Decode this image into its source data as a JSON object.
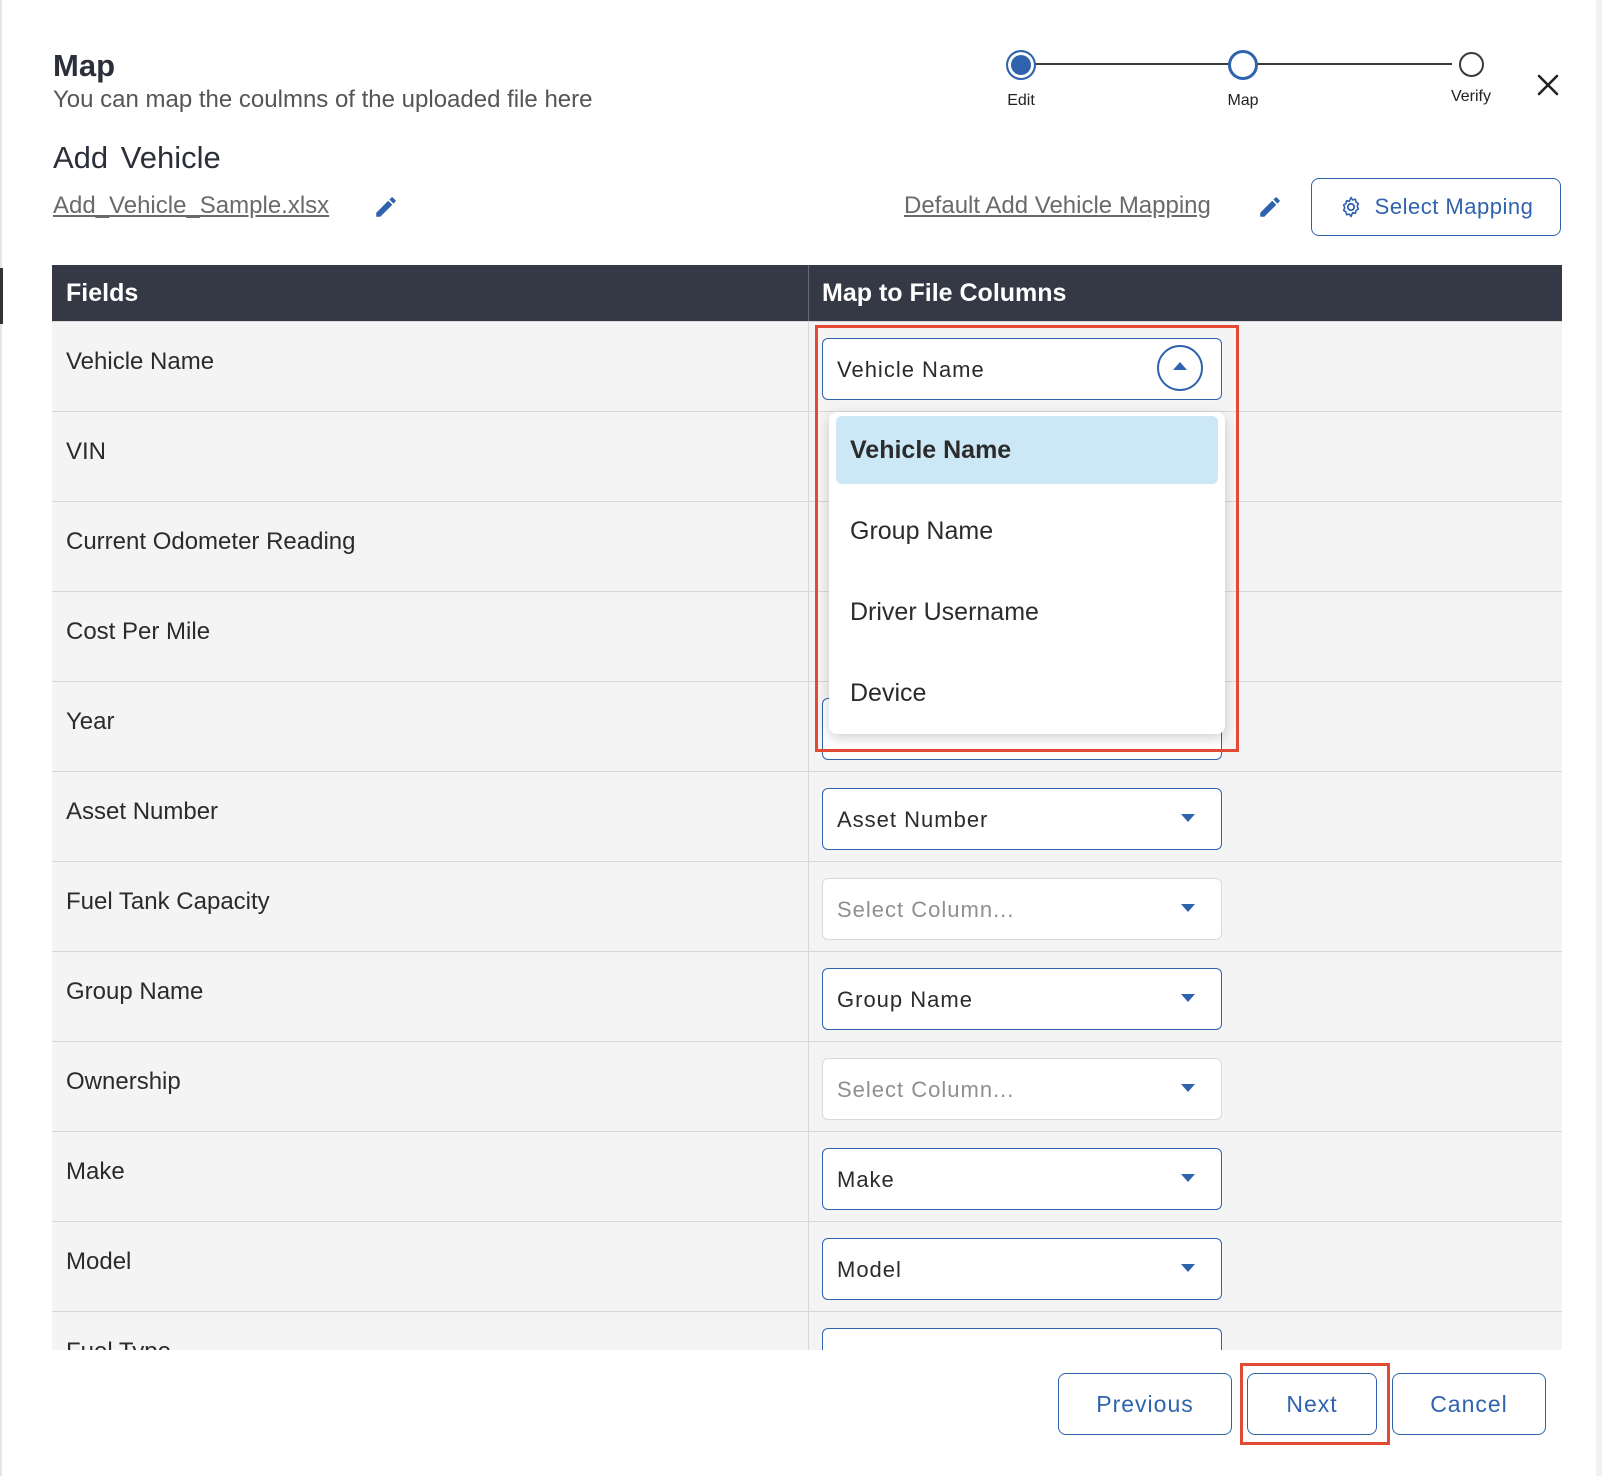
{
  "header": {
    "title": "Map",
    "subtitle": "You can map the coulmns of the uploaded file here",
    "section_title": "Add Vehicle"
  },
  "file": {
    "name": "Add_Vehicle_Sample.xlsx",
    "mapping_name": "Default Add Vehicle Mapping",
    "select_mapping_label": "Select Mapping"
  },
  "stepper": {
    "steps": [
      {
        "label": "Edit",
        "state": "completed"
      },
      {
        "label": "Map",
        "state": "current"
      },
      {
        "label": "Verify",
        "state": "pending"
      }
    ]
  },
  "table": {
    "headers": [
      "Fields",
      "Map to File Columns"
    ],
    "rows": [
      {
        "field": "Vehicle Name",
        "column": "Vehicle Name"
      },
      {
        "field": "VIN",
        "column": ""
      },
      {
        "field": "Current Odometer Reading",
        "column": ""
      },
      {
        "field": "Cost Per Mile",
        "column": ""
      },
      {
        "field": "Year",
        "column": ""
      },
      {
        "field": "Asset Number",
        "column": "Asset Number"
      },
      {
        "field": "Fuel Tank Capacity",
        "column": "Select Column..."
      },
      {
        "field": "Group Name",
        "column": "Group Name"
      },
      {
        "field": "Ownership",
        "column": "Select Column..."
      },
      {
        "field": "Make",
        "column": "Make"
      },
      {
        "field": "Model",
        "column": "Model"
      },
      {
        "field": "Fuel Type",
        "column": ""
      }
    ]
  },
  "dropdown": {
    "selected": "Vehicle Name",
    "options": [
      "Vehicle Name",
      "Group Name",
      "Driver Username",
      "Device"
    ]
  },
  "footer": {
    "previous_label": "Previous",
    "next_label": "Next",
    "cancel_label": "Cancel"
  },
  "colors": {
    "accent": "#2f63ad",
    "header_bg": "#353845",
    "highlight": "#e34a33",
    "selected_option_bg": "#cce7f5"
  }
}
